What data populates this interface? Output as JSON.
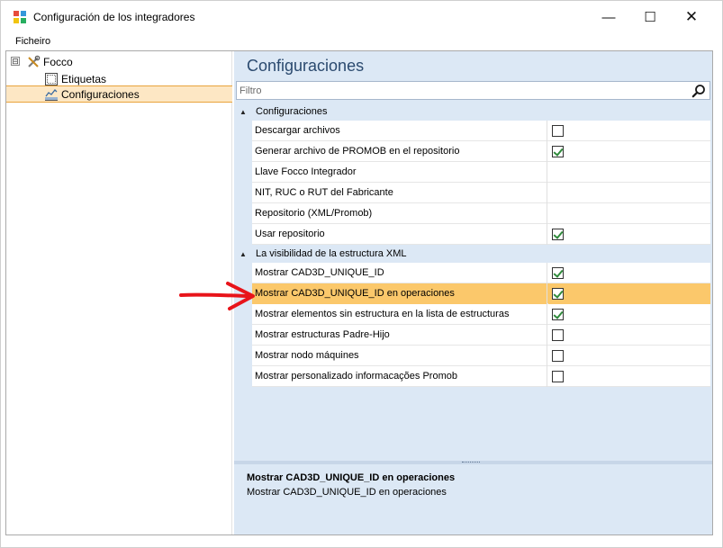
{
  "window": {
    "title": "Configuración de los integradores",
    "min_glyph": "—",
    "max_glyph": "☐",
    "close_glyph": "✕"
  },
  "menu": {
    "items": [
      "Ficheiro"
    ]
  },
  "tree": {
    "root": {
      "label": "Focco",
      "expander": "⊟",
      "icon": "tools-icon"
    },
    "children": [
      {
        "label": "Etiquetas",
        "icon": "label-grid-icon",
        "selected": false
      },
      {
        "label": "Configuraciones",
        "icon": "chart-icon",
        "selected": true
      }
    ]
  },
  "panel": {
    "title": "Configuraciones",
    "filter_placeholder": "Filtro",
    "filter_value": ""
  },
  "grid": {
    "categories": [
      {
        "label": "Configuraciones",
        "toggle": "▲",
        "rows": [
          {
            "name": "Descargar archivos",
            "type": "checkbox",
            "checked": false
          },
          {
            "name": "Generar archivo de PROMOB en el repositorio",
            "type": "checkbox",
            "checked": true
          },
          {
            "name": "Llave Focco Integrador",
            "type": "text",
            "value": ""
          },
          {
            "name": "NIT, RUC o RUT del Fabricante",
            "type": "text",
            "value": ""
          },
          {
            "name": "Repositorio (XML/Promob)",
            "type": "text",
            "value": ""
          },
          {
            "name": "Usar repositorio",
            "type": "checkbox",
            "checked": true
          }
        ]
      },
      {
        "label": "La visibilidad de la estructura XML",
        "toggle": "▲",
        "rows": [
          {
            "name": "Mostrar CAD3D_UNIQUE_ID",
            "type": "checkbox",
            "checked": true
          },
          {
            "name": "Mostrar CAD3D_UNIQUE_ID en operaciones",
            "type": "checkbox",
            "checked": true,
            "selected": true
          },
          {
            "name": "Mostrar elementos sin estructura en la lista de estructuras",
            "type": "checkbox",
            "checked": true
          },
          {
            "name": "Mostrar estructuras Padre-Hijo",
            "type": "checkbox",
            "checked": false
          },
          {
            "name": "Mostrar nodo máquines",
            "type": "checkbox",
            "checked": false
          },
          {
            "name": "Mostrar personalizado informacações Promob",
            "type": "checkbox",
            "checked": false
          }
        ]
      }
    ]
  },
  "description": {
    "title": "Mostrar CAD3D_UNIQUE_ID en operaciones",
    "text": "Mostrar CAD3D_UNIQUE_ID en operaciones"
  },
  "colors": {
    "selection": "#fbc86b",
    "pane_background": "#dce8f5",
    "title_text": "#2b4a6f",
    "annotation_arrow": "#e8141a",
    "check_mark": "#2f8a3b"
  }
}
